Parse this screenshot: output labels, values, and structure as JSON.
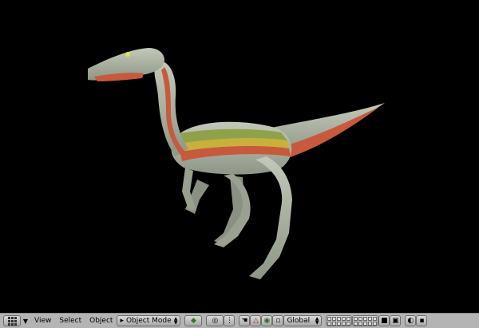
{
  "header": {
    "menus": {
      "view": "View",
      "select": "Select",
      "object": "Object"
    },
    "mode_select": {
      "label": "Object Mode"
    },
    "orientation_select": {
      "label": "Global"
    }
  },
  "colors": {
    "viewport_background": "#000000",
    "header_background": "#b4b4b4",
    "model_skin": "#a6ad9c",
    "stripe_red": "#c75a3c",
    "stripe_yellow": "#c8b03c",
    "stripe_green": "#8fa24a"
  },
  "icons": [
    "editor-type-icon",
    "menu-collapse-icon",
    "mode-icon",
    "draw-type-icon",
    "pivot-icon",
    "snap-icon",
    "manipulator-hand-icon",
    "translate-icon",
    "rotate-icon",
    "lock-layer-icon",
    "render-preview-icon",
    "render-icon"
  ]
}
